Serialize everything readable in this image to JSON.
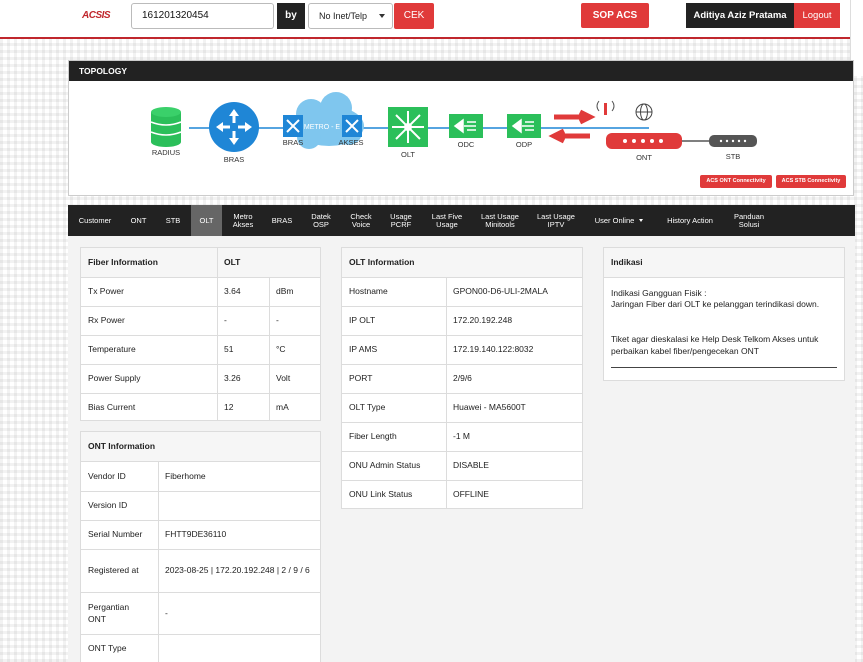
{
  "header": {
    "logo": "ACSIS",
    "search_value": "161201320454",
    "by_label": "by",
    "search_type": "No Inet/Telp",
    "cek_label": "CEK",
    "sop_label": "SOP ACS",
    "user_name": "Aditiya Aziz Pratama",
    "logout_label": "Logout"
  },
  "topology": {
    "title": "TOPOLOGY",
    "nodes": {
      "radius": "RADIUS",
      "bras": "BRAS",
      "metro_bras": "BRAS",
      "metro": "METRO - E",
      "akses": "AKSES",
      "olt": "OLT",
      "odc": "ODC",
      "odp": "ODP",
      "ont": "ONT",
      "stb": "STB"
    },
    "acs_ont_btn": "ACS ONT Connectivity",
    "acs_stb_btn": "ACS STB Connectivity"
  },
  "nav": [
    {
      "label": "Customer"
    },
    {
      "label": "ONT"
    },
    {
      "label": "STB"
    },
    {
      "label": "OLT"
    },
    {
      "label": "Metro Akses"
    },
    {
      "label": "BRAS"
    },
    {
      "label": "Datek OSP"
    },
    {
      "label": "Check Voice"
    },
    {
      "label": "Usage PCRF"
    },
    {
      "label": "Last Five Usage"
    },
    {
      "label": "Last Usage Minitools"
    },
    {
      "label": "Last Usage IPTV"
    },
    {
      "label": "User Online"
    },
    {
      "label": "History Action"
    },
    {
      "label": "Panduan Solusi"
    }
  ],
  "fiber": {
    "header": [
      "Fiber Information",
      "OLT"
    ],
    "rows": [
      {
        "label": "Tx Power",
        "value": "3.64",
        "unit": "dBm"
      },
      {
        "label": "Rx Power",
        "value": "-",
        "unit": "-"
      },
      {
        "label": "Temperature",
        "value": "51",
        "unit": "°C"
      },
      {
        "label": "Power Supply",
        "value": "3.26",
        "unit": "Volt"
      },
      {
        "label": "Bias Current",
        "value": "12",
        "unit": "mA"
      }
    ]
  },
  "ont": {
    "header": "ONT Information",
    "rows": [
      {
        "label": "Vendor ID",
        "value": "Fiberhome"
      },
      {
        "label": "Version ID",
        "value": ""
      },
      {
        "label": "Serial Number",
        "value": "FHTT9DE36110"
      },
      {
        "label": "Registered at",
        "value": "2023-08-25 | 172.20.192.248 | 2 / 9 / 6"
      },
      {
        "label": "Pergantian ONT",
        "value": "-"
      },
      {
        "label": "ONT Type",
        "value": ""
      }
    ]
  },
  "olt": {
    "header": "OLT Information",
    "rows": [
      {
        "label": "Hostname",
        "value": "GPON00-D6-ULI-2MALA"
      },
      {
        "label": "IP OLT",
        "value": "172.20.192.248"
      },
      {
        "label": "IP AMS",
        "value": "172.19.140.122:8032"
      },
      {
        "label": "PORT",
        "value": "2/9/6"
      },
      {
        "label": "OLT Type",
        "value": "Huawei - MA5600T"
      },
      {
        "label": "Fiber Length",
        "value": "-1 M"
      },
      {
        "label": "ONU Admin Status",
        "value": "DISABLE"
      },
      {
        "label": "ONU Link Status",
        "value": "OFFLINE"
      }
    ]
  },
  "indikasi": {
    "header": "Indikasi",
    "line1": "Indikasi Gangguan Fisik :",
    "line2": "Jaringan Fiber dari OLT ke pelanggan terindikasi down.",
    "line3": "Tiket agar dieskalasi ke Help Desk Telkom Akses untuk perbaikan kabel fiber/pengecekan ONT"
  },
  "colors": {
    "accent_red": "#e03a3a",
    "node_green": "#2bbf5a",
    "node_blue": "#1f86d6",
    "dark": "#222222"
  }
}
